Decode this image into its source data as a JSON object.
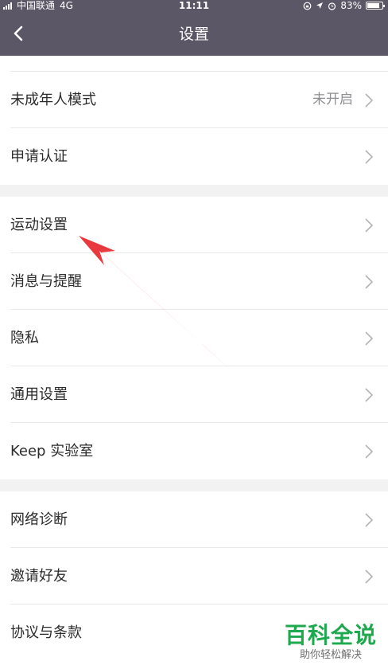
{
  "status_bar": {
    "carrier": "中国联通",
    "network": "4G",
    "time": "11:11",
    "battery": "83%",
    "battery_level": 0.83
  },
  "header": {
    "title": "设置",
    "back_icon": "chevron-left-icon"
  },
  "group1": {
    "items": [
      {
        "label": "未成年人模式",
        "value": "未开启"
      },
      {
        "label": "申请认证"
      }
    ]
  },
  "group2": {
    "items": [
      {
        "label": "运动设置"
      },
      {
        "label": "消息与提醒"
      },
      {
        "label": "隐私"
      },
      {
        "label": "通用设置"
      },
      {
        "label": "Keep 实验室"
      }
    ]
  },
  "group3": {
    "items": [
      {
        "label": "网络诊断"
      },
      {
        "label": "邀请好友"
      },
      {
        "label": "协议与条款"
      }
    ]
  },
  "annotation": {
    "color": "#e8393f",
    "shape": "arrow"
  },
  "watermark": {
    "title": "百科全说",
    "subtitle": "助你轻松解决"
  },
  "colors": {
    "header": "#5b5766",
    "accent": "#1ea94e"
  }
}
